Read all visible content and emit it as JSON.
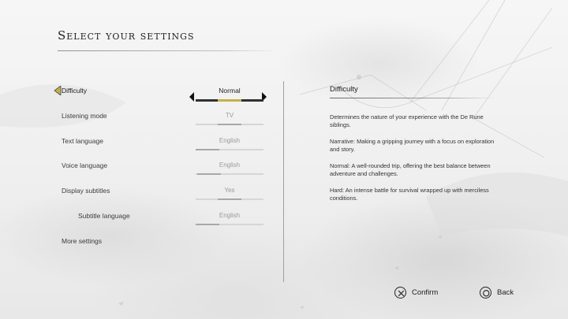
{
  "header": {
    "title": "Select your settings"
  },
  "settings": [
    {
      "name": "difficulty",
      "label": "Difficulty",
      "value": "Normal",
      "selected": true,
      "level": 0.5
    },
    {
      "name": "listening-mode",
      "label": "Listening mode",
      "value": "TV",
      "selected": false,
      "level": 0.5
    },
    {
      "name": "text-language",
      "label": "Text language",
      "value": "English",
      "selected": false,
      "level": 0.08
    },
    {
      "name": "voice-language",
      "label": "Voice language",
      "value": "English",
      "selected": false,
      "level": 0.2
    },
    {
      "name": "display-subtitles",
      "label": "Display subtitles",
      "value": "Yes",
      "selected": false,
      "level": 0.5
    },
    {
      "name": "subtitle-language",
      "label": "Subtitle language",
      "value": "English",
      "selected": false,
      "level": 0.08,
      "indent": true
    },
    {
      "name": "more-settings",
      "label": "More settings",
      "value": "",
      "selected": false
    }
  ],
  "description": {
    "title": "Difficulty",
    "paragraphs": [
      "Determines the nature of your experience with the De Rune siblings.",
      "Narrative:  Making a gripping journey with a focus on exploration and story.",
      "Normal: A well-rounded trip, offering the best balance between adventure and challenges.",
      "Hard: An intense battle for survival wrapped up with merciless conditions."
    ]
  },
  "footer": {
    "confirm_label": "Confirm",
    "back_label": "Back",
    "confirm_icon": "cross-button-icon",
    "back_icon": "circle-button-icon"
  },
  "colors": {
    "accent": "#c4b04a",
    "text": "#2a2a2a",
    "muted": "#9a9a9a"
  }
}
